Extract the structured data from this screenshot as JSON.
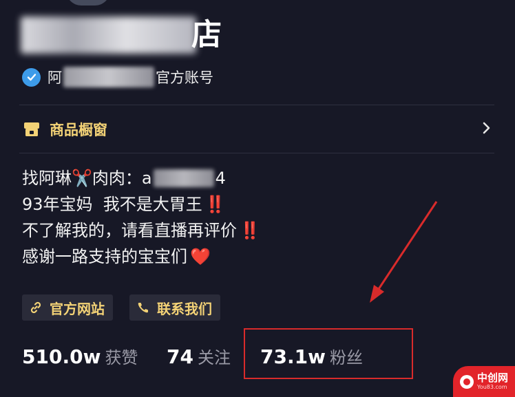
{
  "profile": {
    "shop_name_visible_suffix": "店",
    "verified_prefix": "阿",
    "verified_suffix": "官方账号"
  },
  "showcase": {
    "label": "商品橱窗"
  },
  "bio": {
    "line1_prefix": "找阿琳",
    "line1_emoji": "✂️",
    "line1_middle": "肉肉：a",
    "line1_suffix": "4",
    "line2": "93年宝妈  我不是大胃王",
    "line2_mark": "‼️",
    "line3": "不了解我的，请看直播再评价",
    "line3_mark": "‼️",
    "line4": "感谢一路支持的宝宝们",
    "line4_emoji": "❤️"
  },
  "buttons": {
    "website": "官方网站",
    "contact": "联系我们"
  },
  "stats": {
    "likes_value": "510.0w",
    "likes_label": "获赞",
    "following_value": "74",
    "following_label": "关注",
    "followers_value": "73.1w",
    "followers_label": "粉丝"
  },
  "watermark": {
    "title": "中创网",
    "sub": "You83.com"
  },
  "colors": {
    "background": "#171826",
    "accent_gold": "#f3d276",
    "verified_blue": "#3d9be9",
    "annotation_red": "#d92b2b",
    "heart_red": "#e8383d"
  },
  "icons": {
    "verified": "verified-check-icon",
    "showcase": "shop-window-icon",
    "chevron": "chevron-right-icon",
    "website": "link-icon",
    "contact": "phone-icon"
  }
}
